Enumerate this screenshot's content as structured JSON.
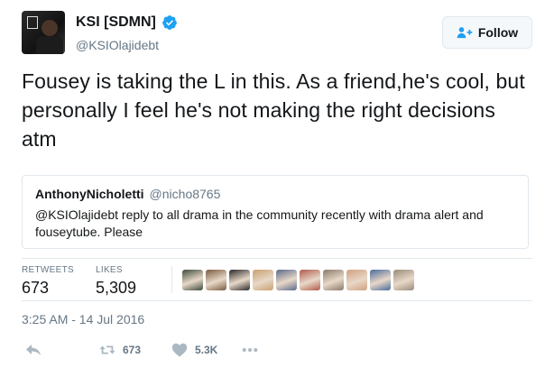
{
  "author": {
    "display_name": "KSI [SDMN]",
    "handle": "@KSIOlajidebt",
    "verified": true
  },
  "follow_button": {
    "label": "Follow"
  },
  "tweet": {
    "text": "Fousey is taking the L in this. As a friend,he's cool, but personally I feel he's not making the right decisions atm"
  },
  "quoted_tweet": {
    "display_name": "AnthonyNicholetti",
    "handle": "@nicho8765",
    "text": "@KSIOlajidebt reply to all drama in the community recently with drama alert and fouseytube. Please"
  },
  "stats": {
    "retweets_label": "RETWEETS",
    "retweets_value": "673",
    "likes_label": "LIKES",
    "likes_value": "5,309"
  },
  "liker_avatars": [
    "#3d4a3a",
    "#7a5a40",
    "#2a2a2a",
    "#c8a070",
    "#5a6a8a",
    "#b05a4a",
    "#8a7a6a",
    "#d0a080",
    "#4a6a9a",
    "#9a8a7a"
  ],
  "timestamp": "3:25 AM - 14 Jul 2016",
  "actions": {
    "retweet_count": "673",
    "like_count": "5.3K"
  },
  "colors": {
    "verified": "#1da1f2",
    "secondary_text": "#657786",
    "border": "#e1e8ed"
  }
}
